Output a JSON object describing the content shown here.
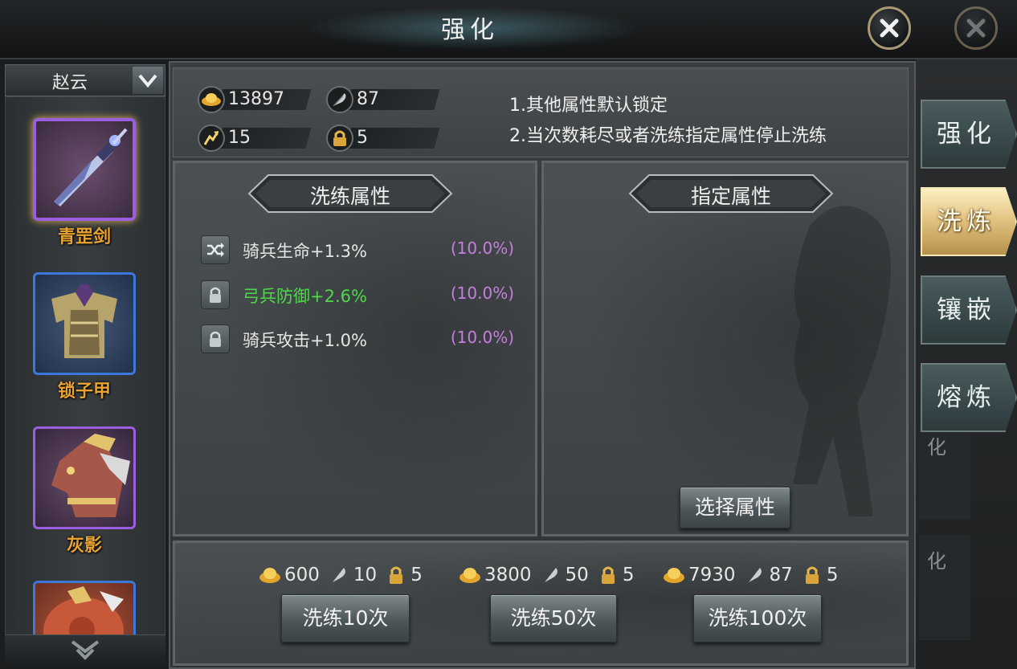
{
  "header": {
    "title": "强化"
  },
  "character_select": {
    "name": "赵云"
  },
  "equipment": [
    {
      "name": "青罡剑",
      "rarity_color": "#8a4fd1",
      "selected": true
    },
    {
      "name": "锁子甲",
      "rarity_color": "#2d6fd8",
      "selected": false
    },
    {
      "name": "灰影",
      "rarity_color": "#8a4fd1",
      "selected": false
    },
    {
      "name": "",
      "rarity_color": "#2d6fd8",
      "selected": false
    }
  ],
  "resources": {
    "gold": "13897",
    "feather": "87",
    "upgrade": "15",
    "lock": "5"
  },
  "notice": {
    "line1": "1.其他属性默认锁定",
    "line2": "2.当次数耗尽或者洗练指定属性停止洗练"
  },
  "refine_panel": {
    "title": "洗练属性",
    "attributes": [
      {
        "label": "骑兵生命+1.3%",
        "chance": "(10.0%)",
        "button_icon": "shuffle-icon",
        "highlight": false
      },
      {
        "label": "弓兵防御+2.6%",
        "chance": "(10.0%)",
        "button_icon": "lock-icon",
        "highlight": true
      },
      {
        "label": "骑兵攻击+1.0%",
        "chance": "(10.0%)",
        "button_icon": "lock-icon",
        "highlight": false
      }
    ]
  },
  "target_panel": {
    "title": "指定属性",
    "select_button": "选择属性"
  },
  "actions": [
    {
      "gold": "600",
      "feather": "10",
      "lock": "5",
      "label": "洗练10次"
    },
    {
      "gold": "3800",
      "feather": "50",
      "lock": "5",
      "label": "洗练50次"
    },
    {
      "gold": "7930",
      "feather": "87",
      "lock": "5",
      "label": "洗练100次"
    }
  ],
  "tabs": [
    {
      "label": "强化",
      "active": false
    },
    {
      "label": "洗炼",
      "active": true
    },
    {
      "label": "镶嵌",
      "active": false
    },
    {
      "label": "熔炼",
      "active": false
    }
  ],
  "background_tab_fragment": "化",
  "colors": {
    "highlight_green": "#4fd84b",
    "chance_purple": "#c87ee0",
    "item_name_orange": "#e8a330",
    "active_tab_gold": "#e4c583"
  }
}
